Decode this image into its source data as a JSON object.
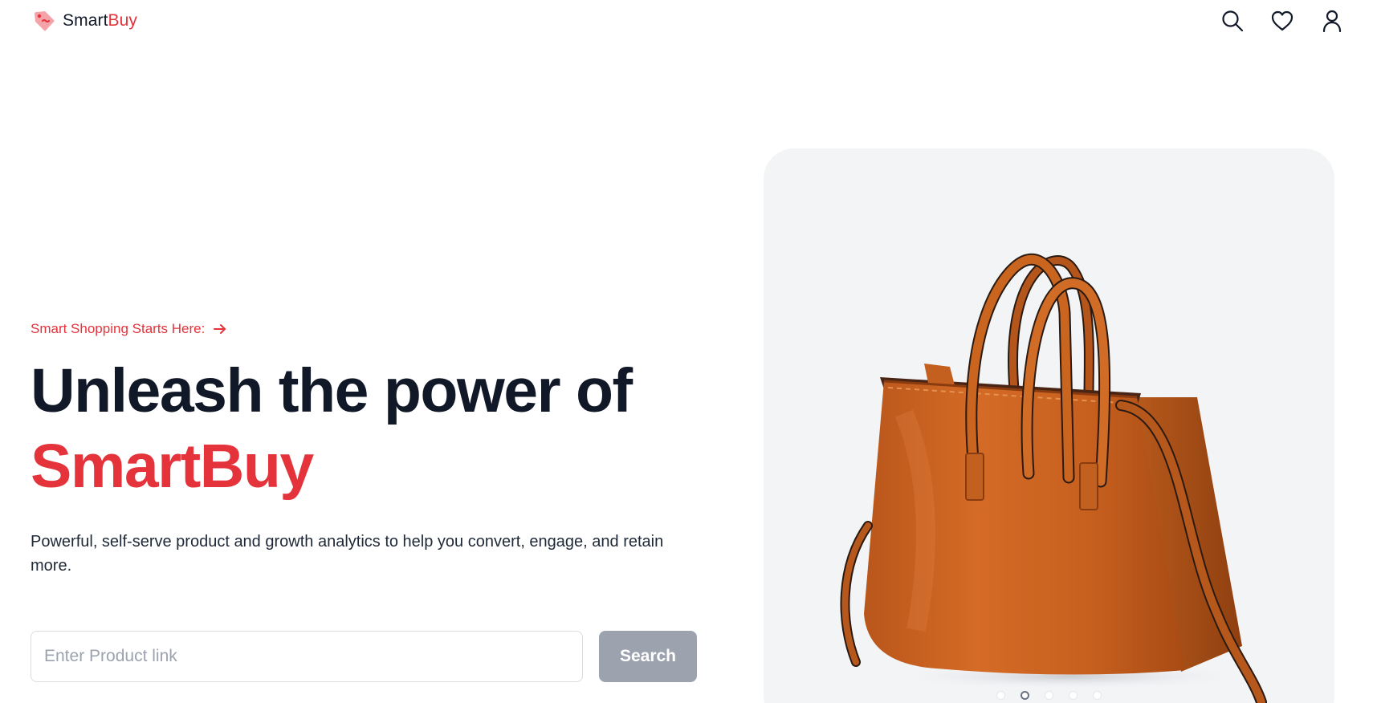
{
  "header": {
    "brand_part1": "Smart",
    "brand_part2": "Buy",
    "icons": [
      "search-icon",
      "heart-icon",
      "user-icon"
    ]
  },
  "hero": {
    "eyebrow": "Smart Shopping Starts Here:",
    "headline_line1": "Unleash the power of",
    "headline_line2": "SmartBuy",
    "description": "Powerful, self-serve product and growth analytics to help you convert, engage, and retain more.",
    "search": {
      "placeholder": "Enter Product link",
      "value": "",
      "button_label": "Search"
    }
  },
  "carousel": {
    "slide_count": 5,
    "active_index": 1
  },
  "colors": {
    "accent": "#e5333c",
    "heading": "#111827",
    "button_disabled": "#9ca3af",
    "card_background": "#f3f4f6"
  }
}
